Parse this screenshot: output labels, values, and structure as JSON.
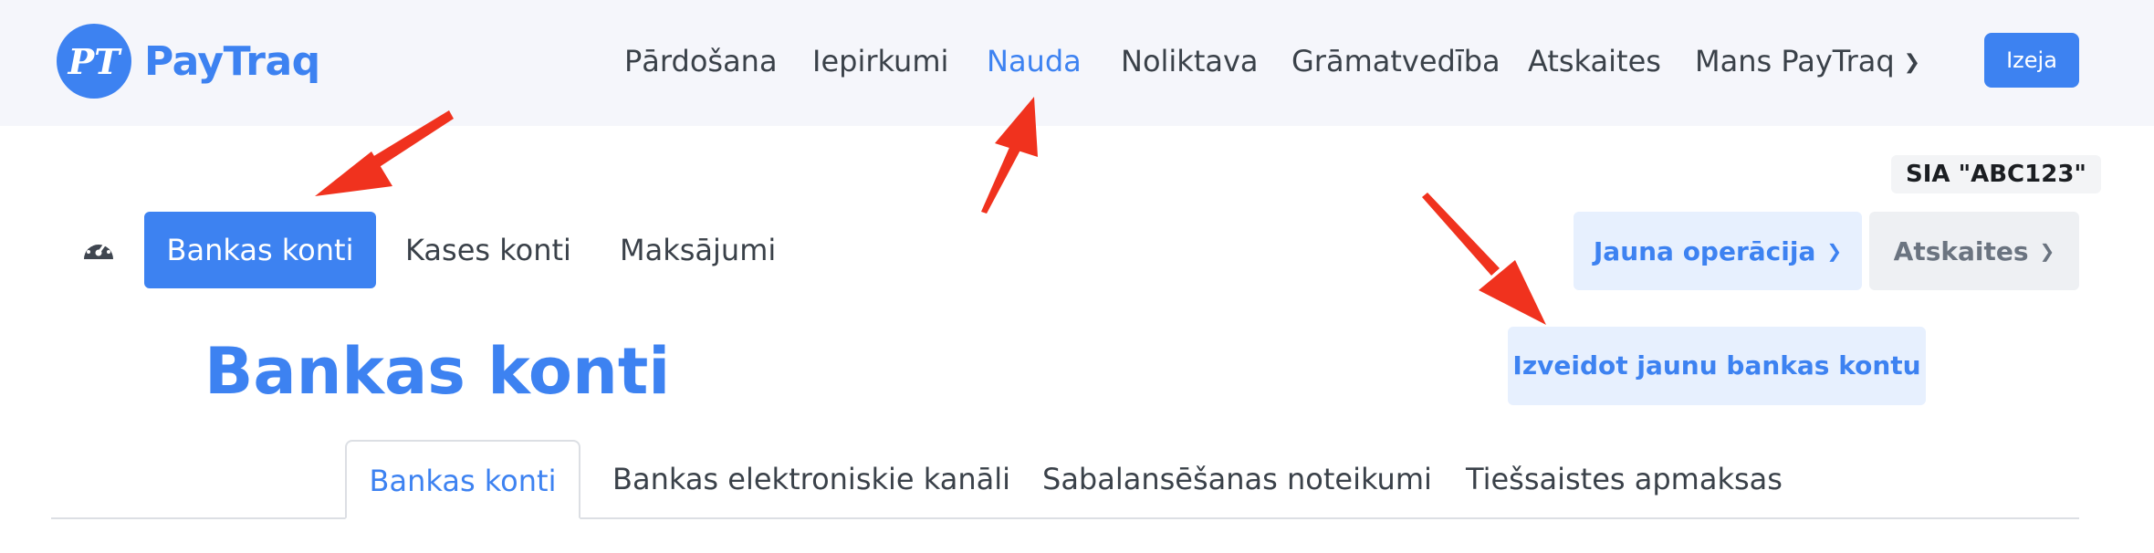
{
  "logo": {
    "mark": "PT",
    "text": "PayTraq"
  },
  "topnav": {
    "items": [
      {
        "label": "Pārdošana"
      },
      {
        "label": "Iepirkumi"
      },
      {
        "label": "Nauda",
        "active": true
      },
      {
        "label": "Noliktava"
      },
      {
        "label": "Grāmatvedība"
      },
      {
        "label": "Atskaites"
      },
      {
        "label": "Mans PayTraq",
        "chevron": "chevron-down-icon"
      }
    ],
    "exit_label": "Izeja"
  },
  "company": "SIA \"ABC123\"",
  "subnav": {
    "icon": "gauge-icon",
    "items": [
      {
        "label": "Bankas konti",
        "active": true
      },
      {
        "label": "Kases konti"
      },
      {
        "label": "Maksājumi"
      }
    ],
    "new_operation_label": "Jauna operācija",
    "reports_label": "Atskaites"
  },
  "page": {
    "title": "Bankas konti",
    "create_button": "Izveidot jaunu bankas kontu"
  },
  "tabs": [
    {
      "label": "Bankas konti",
      "active": true
    },
    {
      "label": "Bankas elektroniskie kanāli"
    },
    {
      "label": "Sabalansēšanas noteikumi"
    },
    {
      "label": "Tiešsaistes apmaksas"
    }
  ],
  "colors": {
    "accent": "#3d82f1",
    "arrow": "#f0321e",
    "topbar_bg": "#f5f6fb"
  }
}
